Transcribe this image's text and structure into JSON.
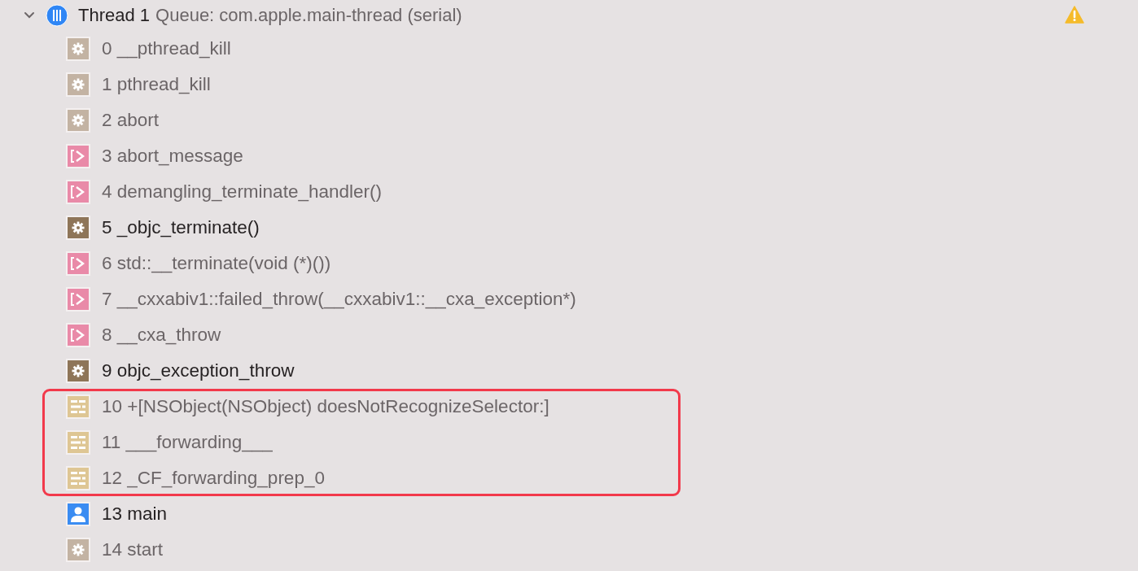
{
  "thread": {
    "expanded": true,
    "title": "Thread 1",
    "queue": "Queue: com.apple.main-thread (serial)",
    "warning": true
  },
  "frames": [
    {
      "kind": "system",
      "label": "0 __pthread_kill",
      "highlighted": false
    },
    {
      "kind": "system",
      "label": "1 pthread_kill",
      "highlighted": false
    },
    {
      "kind": "system",
      "label": "2 abort",
      "highlighted": false
    },
    {
      "kind": "cpp",
      "label": "3 abort_message",
      "highlighted": false
    },
    {
      "kind": "cpp",
      "label": "4 demangling_terminate_handler()",
      "highlighted": false
    },
    {
      "kind": "symbol",
      "label": "5 _objc_terminate()",
      "highlighted": false
    },
    {
      "kind": "cpp",
      "label": "6 std::__terminate(void (*)())",
      "highlighted": false
    },
    {
      "kind": "cpp",
      "label": "7 __cxxabiv1::failed_throw(__cxxabiv1::__cxa_exception*)",
      "highlighted": false
    },
    {
      "kind": "cpp",
      "label": "8 __cxa_throw",
      "highlighted": false
    },
    {
      "kind": "symbol",
      "label": "9 objc_exception_throw",
      "highlighted": false
    },
    {
      "kind": "framework",
      "label": "10 +[NSObject(NSObject) doesNotRecognizeSelector:]",
      "highlighted": true
    },
    {
      "kind": "framework",
      "label": "11 ___forwarding___",
      "highlighted": true
    },
    {
      "kind": "framework",
      "label": "12 _CF_forwarding_prep_0",
      "highlighted": true
    },
    {
      "kind": "user",
      "label": "13 main",
      "highlighted": false
    },
    {
      "kind": "system",
      "label": "14 start",
      "highlighted": false
    }
  ]
}
